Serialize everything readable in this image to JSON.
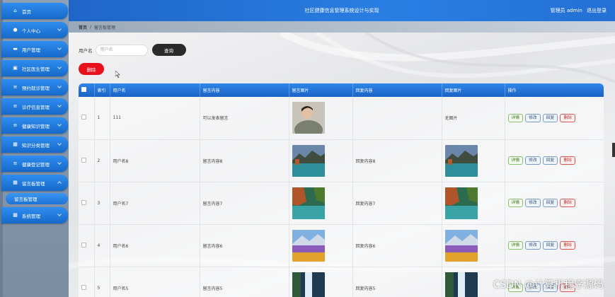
{
  "header": {
    "title": "社区健康信息管理系统设计与实现",
    "admin_label": "管理员 admin",
    "logout": "退出登录"
  },
  "sidebar": {
    "items": [
      {
        "label": "首页",
        "icon": "home-icon"
      },
      {
        "label": "个人中心",
        "icon": "user-icon"
      },
      {
        "label": "用户管理",
        "icon": "monitor-icon"
      },
      {
        "label": "社区医生管理",
        "icon": "doctor-icon"
      },
      {
        "label": "预约就诊管理",
        "icon": "list-icon"
      },
      {
        "label": "诊疗信息管理",
        "icon": "list-icon"
      },
      {
        "label": "健康知识管理",
        "icon": "list-icon"
      },
      {
        "label": "知识分类管理",
        "icon": "grid-icon"
      },
      {
        "label": "健康登记管理",
        "icon": "list-icon"
      },
      {
        "label": "留言板管理",
        "icon": "grid-icon"
      }
    ],
    "sub_item": "留言板管理",
    "system_item": "系统管理"
  },
  "breadcrumb": {
    "home": "首页",
    "sep": "/",
    "current": "留言板管理"
  },
  "search": {
    "label": "用户名",
    "placeholder": "用户名",
    "button": "查询"
  },
  "actions": {
    "delete": "删除"
  },
  "table": {
    "headers": [
      "索引",
      "用户名",
      "留言内容",
      "留言图片",
      "回复内容",
      "回复图片",
      "操作"
    ],
    "ops": {
      "detail": "详情",
      "edit": "修改",
      "reply": "回复",
      "delete": "删除"
    },
    "rows": [
      {
        "idx": "1",
        "user": "111",
        "content": "可以发表留言",
        "reply": "",
        "reply_img": "无图片"
      },
      {
        "idx": "2",
        "user": "用户名8",
        "content": "留言内容8",
        "reply": "回复内容8",
        "reply_img": ""
      },
      {
        "idx": "3",
        "user": "用户名7",
        "content": "留言内容7",
        "reply": "回复内容7",
        "reply_img": ""
      },
      {
        "idx": "4",
        "user": "用户名6",
        "content": "留言内容6",
        "reply": "回复内容6",
        "reply_img": ""
      },
      {
        "idx": "5",
        "user": "用户名5",
        "content": "留言内容5",
        "reply": "回复内容5",
        "reply_img": ""
      }
    ]
  },
  "watermark": "CSDN @计算机程序源码"
}
